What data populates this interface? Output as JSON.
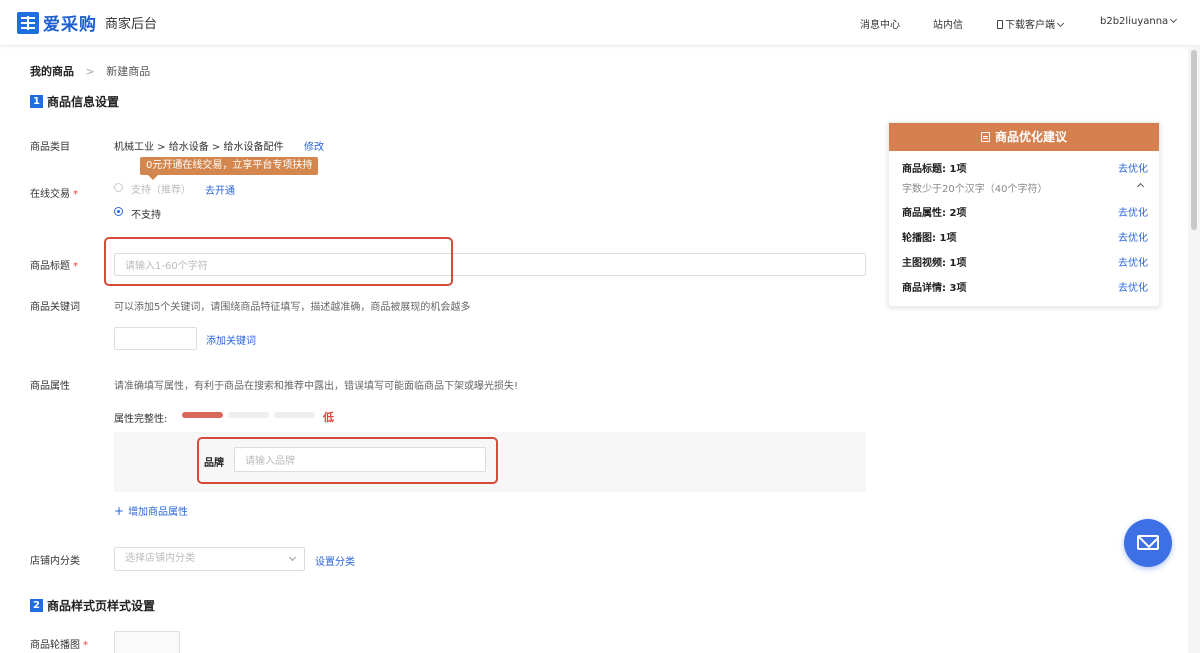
{
  "header": {
    "logo_text": "爱采购",
    "logo_sub": "商家后台",
    "nav": {
      "messages": "消息中心",
      "inbox": "站内信",
      "download": "下载客户端",
      "user": "b2b2liuyanna"
    }
  },
  "breadcrumb": {
    "first": "我的商品",
    "current": "新建商品"
  },
  "section1": {
    "number": "1",
    "title": "商品信息设置"
  },
  "category": {
    "label": "商品类目",
    "value": "机械工业 > 给水设备 > 给水设备配件",
    "edit": "修改"
  },
  "online_trade": {
    "label": "在线交易",
    "required": "*",
    "tooltip": "0元开通在线交易，立享平台专项扶持",
    "option_support": "支持（推荐）",
    "open_link": "去开通",
    "option_no": "不支持"
  },
  "title_field": {
    "label": "商品标题",
    "required": "*",
    "placeholder": "请输入1-60个字符"
  },
  "keywords": {
    "label": "商品关键词",
    "hint": "可以添加5个关键词，请围绕商品特征填写，描述越准确，商品被展现的机会越多",
    "add": "添加关键词"
  },
  "attributes": {
    "label": "商品属性",
    "hint": "请准确填写属性，有利于商品在搜索和推荐中露出，错误填写可能面临商品下架或曝光损失!",
    "completeness_label": "属性完整性:",
    "completeness_level": "低",
    "completeness_fraction": 0.33,
    "brand_label": "品牌",
    "brand_placeholder": "请输入品牌",
    "add_attr": "增加商品属性"
  },
  "store_category": {
    "label": "店铺内分类",
    "placeholder": "选择店铺内分类",
    "set": "设置分类"
  },
  "section2": {
    "number": "2",
    "title": "商品样式页样式设置"
  },
  "carousel": {
    "label": "商品轮播图",
    "required": "*"
  },
  "suggestions": {
    "title": "商品优化建议",
    "title_row": {
      "label": "商品标题: 1项",
      "link": "去优化",
      "detail": "字数少于20个汉字（40个字符）"
    },
    "attr_row": {
      "label": "商品属性: 2项",
      "link": "去优化"
    },
    "carousel_row": {
      "label": "轮播图: 1项",
      "link": "去优化"
    },
    "video_row": {
      "label": "主图视频: 1项",
      "link": "去优化"
    },
    "detail_row": {
      "label": "商品详情: 3项",
      "link": "去优化"
    }
  },
  "colors": {
    "brand_blue": "#1d6fe0",
    "link_blue": "#2a66d8",
    "suggestion_orange": "#d7804f",
    "highlight_red": "#d44b3a",
    "progress_red": "#d9685d",
    "progress_empty": "#eeeeee"
  }
}
